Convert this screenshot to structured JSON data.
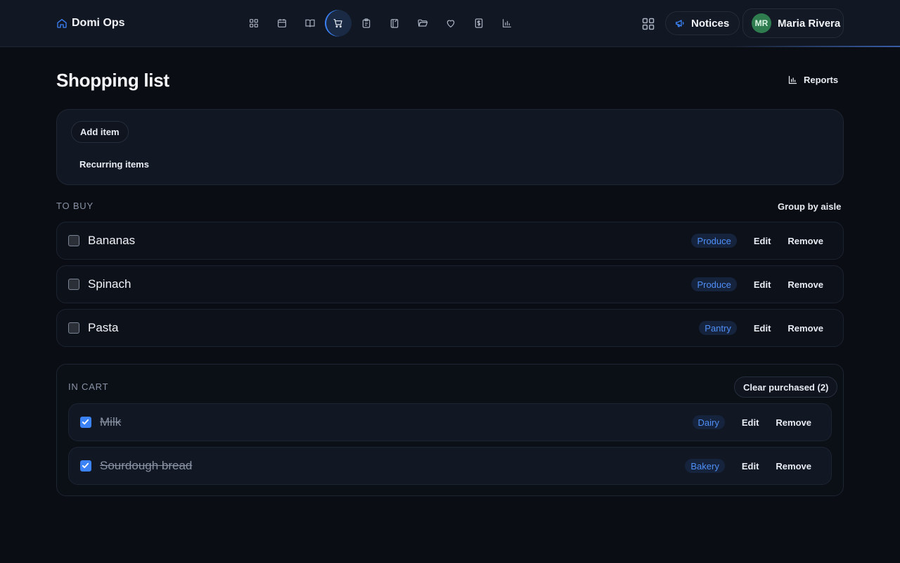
{
  "header": {
    "brand": "Domi Ops",
    "nav_icons": [
      "grid-icon",
      "calendar-icon",
      "book-icon",
      "cart-icon",
      "clipboard-icon",
      "notebook-icon",
      "folder-icon",
      "heart-icon",
      "dollar-icon",
      "chart-icon"
    ],
    "active_nav": "cart-icon",
    "notices_label": "Notices",
    "user": {
      "initials": "MR",
      "name": "Maria Rivera"
    }
  },
  "page": {
    "title": "Shopping list",
    "reports_label": "Reports"
  },
  "actions": {
    "add_item": "Add item",
    "recurring_items": "Recurring items"
  },
  "to_buy": {
    "label": "TO BUY",
    "group_by": "Group by aisle",
    "items": [
      {
        "name": "Bananas",
        "tag": "Produce",
        "checked": false
      },
      {
        "name": "Spinach",
        "tag": "Produce",
        "checked": false
      },
      {
        "name": "Pasta",
        "tag": "Pantry",
        "checked": false
      }
    ]
  },
  "in_cart": {
    "label": "IN CART",
    "clear_label": "Clear purchased (2)",
    "items": [
      {
        "name": "Milk",
        "tag": "Dairy",
        "checked": true
      },
      {
        "name": "Sourdough bread",
        "tag": "Bakery",
        "checked": true
      }
    ]
  },
  "row_actions": {
    "edit": "Edit",
    "remove": "Remove"
  },
  "colors": {
    "accent": "#3b82f6",
    "background": "#0a0d13",
    "surface": "#111723",
    "avatar": "#2f7d4f"
  }
}
